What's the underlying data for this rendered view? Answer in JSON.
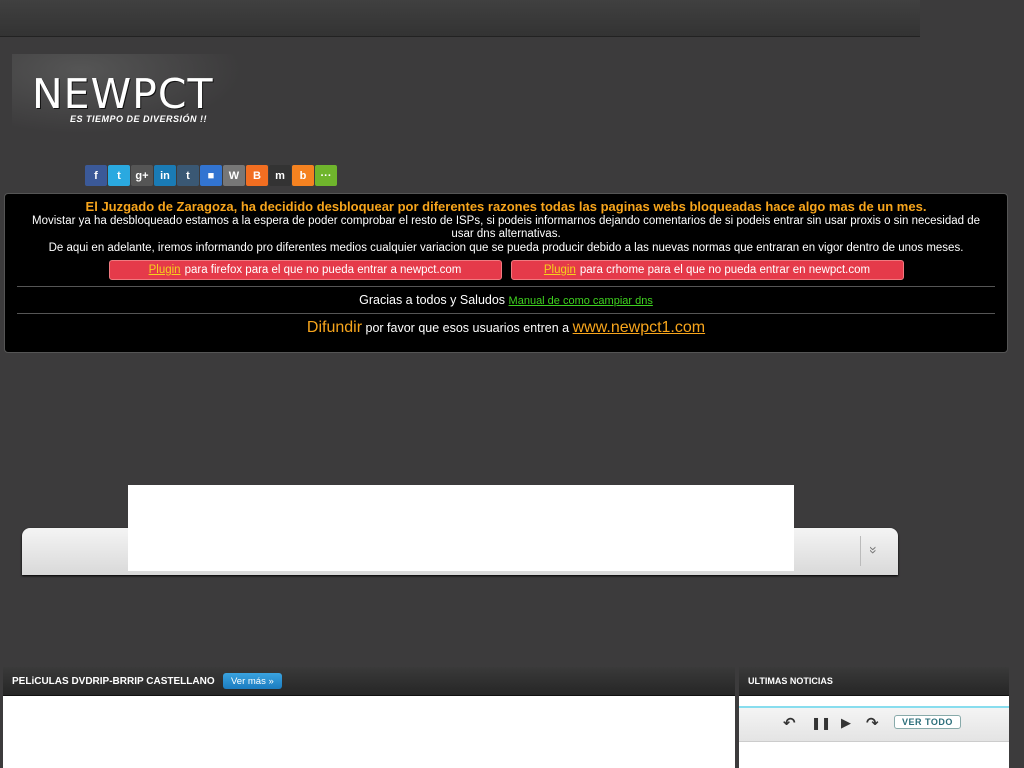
{
  "logo": {
    "brand": "NEWPCT",
    "tagline": "ES TIEMPO DE DIVERSIÓN !!"
  },
  "social_icons": [
    {
      "name": "facebook-icon",
      "glyph": "f",
      "color": "#3b5998"
    },
    {
      "name": "twitter-icon",
      "glyph": "t",
      "color": "#2aa9e0"
    },
    {
      "name": "google-plus-icon",
      "glyph": "g+",
      "color": "#555555"
    },
    {
      "name": "linkedin-icon",
      "glyph": "in",
      "color": "#1a7bb5"
    },
    {
      "name": "tumblr-icon",
      "glyph": "t",
      "color": "#3a5874"
    },
    {
      "name": "delicious-icon",
      "glyph": "■",
      "color": "#3274d1"
    },
    {
      "name": "wordpress-icon",
      "glyph": "W",
      "color": "#777777"
    },
    {
      "name": "blogger-icon",
      "glyph": "B",
      "color": "#f26e21"
    },
    {
      "name": "myspace-icon",
      "glyph": "m",
      "color": "#333333"
    },
    {
      "name": "bitacoras-icon",
      "glyph": "b",
      "color": "#f58220"
    },
    {
      "name": "share-more-icon",
      "glyph": "···",
      "color": "#6fb52c"
    }
  ],
  "notice": {
    "headline": "El Juzgado de Zaragoza, ha decidido desbloquear por diferentes razones todas las paginas webs bloqueadas hace algo mas de un mes.",
    "body1": "Movistar ya ha desbloqueado estamos a la espera de poder comprobar el resto de ISPs, si podeis informarnos dejando comentarios de si podeis entrar sin usar proxis o sin necesidad de usar dns alternativas.",
    "body2": "De aqui en adelante, iremos informando pro diferentes medios cualquier variacion que se pueda producir debido a las nuevas normas que entraran en vigor dentro de unos meses.",
    "plugin_firefox": {
      "link": "Plugin",
      "text": "para firefox para el que no pueda entrar a newpct.com"
    },
    "plugin_chrome": {
      "link": "Plugin",
      "text": "para crhome para el que no pueda entrar en newpct.com"
    },
    "thanks": "Gracias a todos y Saludos",
    "dns_link": "Manual de como campiar dns",
    "spread_word": "Difundir",
    "spread_text": "por favor que esos usuarios entren a",
    "spread_url": "www.newpct1.com"
  },
  "slider": {
    "chevron": "»"
  },
  "movies": {
    "title": "PELiCULAS DVDRIP-BRRIP CASTELLANO",
    "ver_mas": "Ver más »"
  },
  "news": {
    "title": "ULTIMAS NOTICIAS",
    "controls": {
      "prev": "↶",
      "pause": "❚❚",
      "play": "▶",
      "next": "↷"
    },
    "ver_todo": "VER TODO"
  }
}
